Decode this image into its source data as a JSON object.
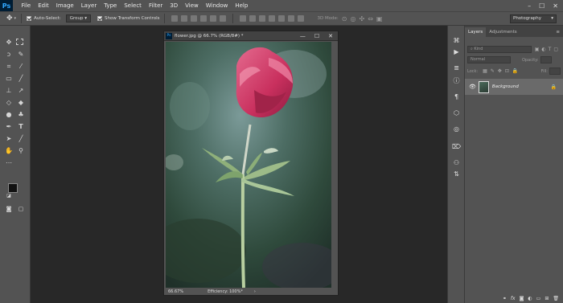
{
  "app": {
    "logo": "Ps",
    "menu": [
      "File",
      "Edit",
      "Image",
      "Layer",
      "Type",
      "Select",
      "Filter",
      "3D",
      "View",
      "Window",
      "Help"
    ],
    "window_controls": [
      "–",
      "☐",
      "✕"
    ]
  },
  "options_bar": {
    "auto_select_label": "Auto-Select:",
    "auto_select_value": "Group",
    "show_transform_label": "Show Transform Controls",
    "mode_3d_label": "3D Mode:",
    "workspace": "Photography"
  },
  "document": {
    "title": "flower.jpg @ 66.7% (RGB/8#) *",
    "zoom": "66.67%",
    "status": "Efficiency: 100%*",
    "controls": [
      "—",
      "☐",
      "✕"
    ]
  },
  "tools": {
    "fg_color": "#111111",
    "bg_color": "#ffffff"
  },
  "layers_panel": {
    "tabs": [
      "Layers",
      "Adjustments"
    ],
    "search_placeholder": "Kind",
    "blend_mode": "Normal",
    "opacity_label": "Opacity:",
    "lock_label": "Lock:",
    "fill_label": "Fill:",
    "layer_name": "Background"
  },
  "colors": {
    "chrome": "#535353",
    "dark_chrome": "#424242",
    "canvas": "#282828",
    "flower": "#d43c6a"
  }
}
